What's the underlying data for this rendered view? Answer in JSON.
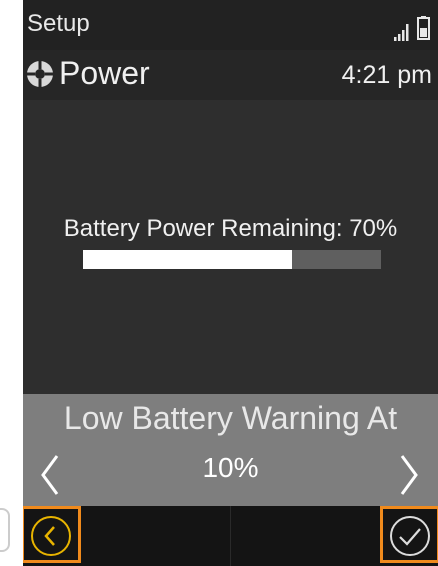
{
  "status_bar": {
    "title": "Setup",
    "signal_icon": "signal-bars-icon",
    "battery_icon": "battery-icon"
  },
  "header": {
    "icon": "power-icon",
    "title": "Power",
    "time": "4:21 pm"
  },
  "battery": {
    "label": "Battery Power Remaining: 70%",
    "level": 0.7
  },
  "warning": {
    "title": "Low Battery Warning At",
    "value": "10%",
    "prev_icon": "chevron-left-icon",
    "next_icon": "chevron-right-icon"
  },
  "softkeys": {
    "back_icon": "back-circle-icon",
    "confirm_icon": "checkmark-circle-icon"
  },
  "colors": {
    "highlight": "#f08a1c",
    "back_icon": "#e8b400",
    "screen_bg": "#2b2b2b",
    "panel_bg": "#7e7e7e"
  }
}
